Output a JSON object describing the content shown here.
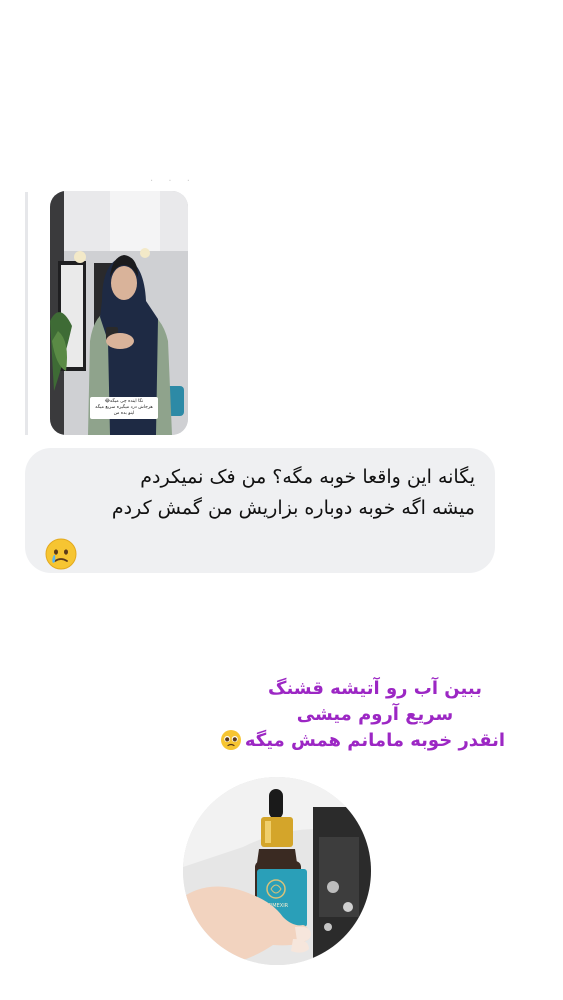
{
  "story": {
    "caption_lines": [
      "نگا اینده چی میگه😂",
      "هرجاش درد میگیره سریع میگه",
      "اینو بده من"
    ]
  },
  "message": {
    "lines": [
      "یگانه این واقعا خوبه مگه؟ من فک نمیکردم",
      "میشه اگه خوبه دوباره بزاریش من گمش کردم"
    ],
    "emoji": "crying-face"
  },
  "overlay": {
    "lines": [
      "ببین آب رو آتیشه قشنگ",
      "سریع آروم میشی",
      "انقدر خوبه مامانم همش میگه"
    ],
    "emoji": "pleading-face",
    "color": "#9c27c4"
  },
  "product": {
    "brand": "DERMEXIR"
  },
  "colors": {
    "bubble_bg": "#eff0f2",
    "accent_purple": "#9c27c4",
    "bottle_label": "#2a9fb8"
  }
}
